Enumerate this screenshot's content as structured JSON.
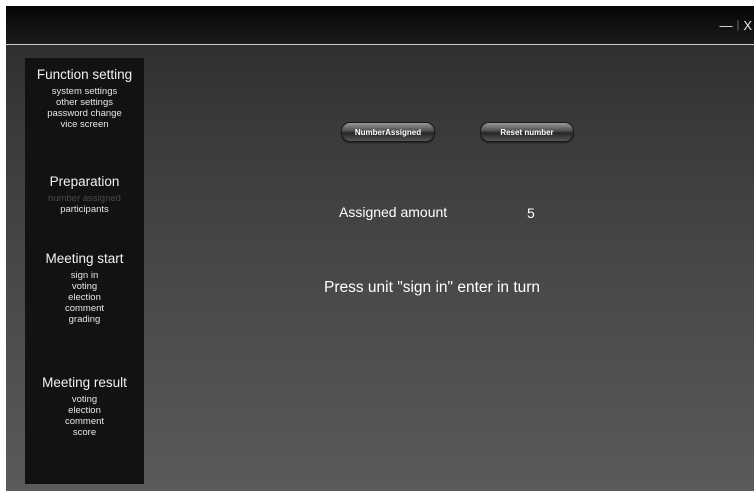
{
  "window": {
    "minimize_glyph": "—",
    "separator": "|",
    "close_glyph": "X"
  },
  "sidebar": {
    "function_setting": {
      "title": "Function setting",
      "items": [
        "system settings",
        "other settings",
        "password change",
        "vice screen"
      ]
    },
    "preparation": {
      "title": "Preparation",
      "items": [
        "number assigned",
        "participants"
      ]
    },
    "meeting_start": {
      "title": "Meeting start",
      "items": [
        "sign in",
        "voting",
        "election",
        "comment",
        "grading"
      ]
    },
    "meeting_result": {
      "title": "Meeting result",
      "items": [
        "voting",
        "election",
        "comment",
        "score"
      ]
    }
  },
  "main": {
    "number_assigned_button": "NumberAssigned",
    "reset_number_button": "Reset number",
    "assigned_amount_label": "Assigned amount",
    "assigned_amount_value": "5",
    "instruction": "Press unit \"sign in\" enter in turn"
  }
}
